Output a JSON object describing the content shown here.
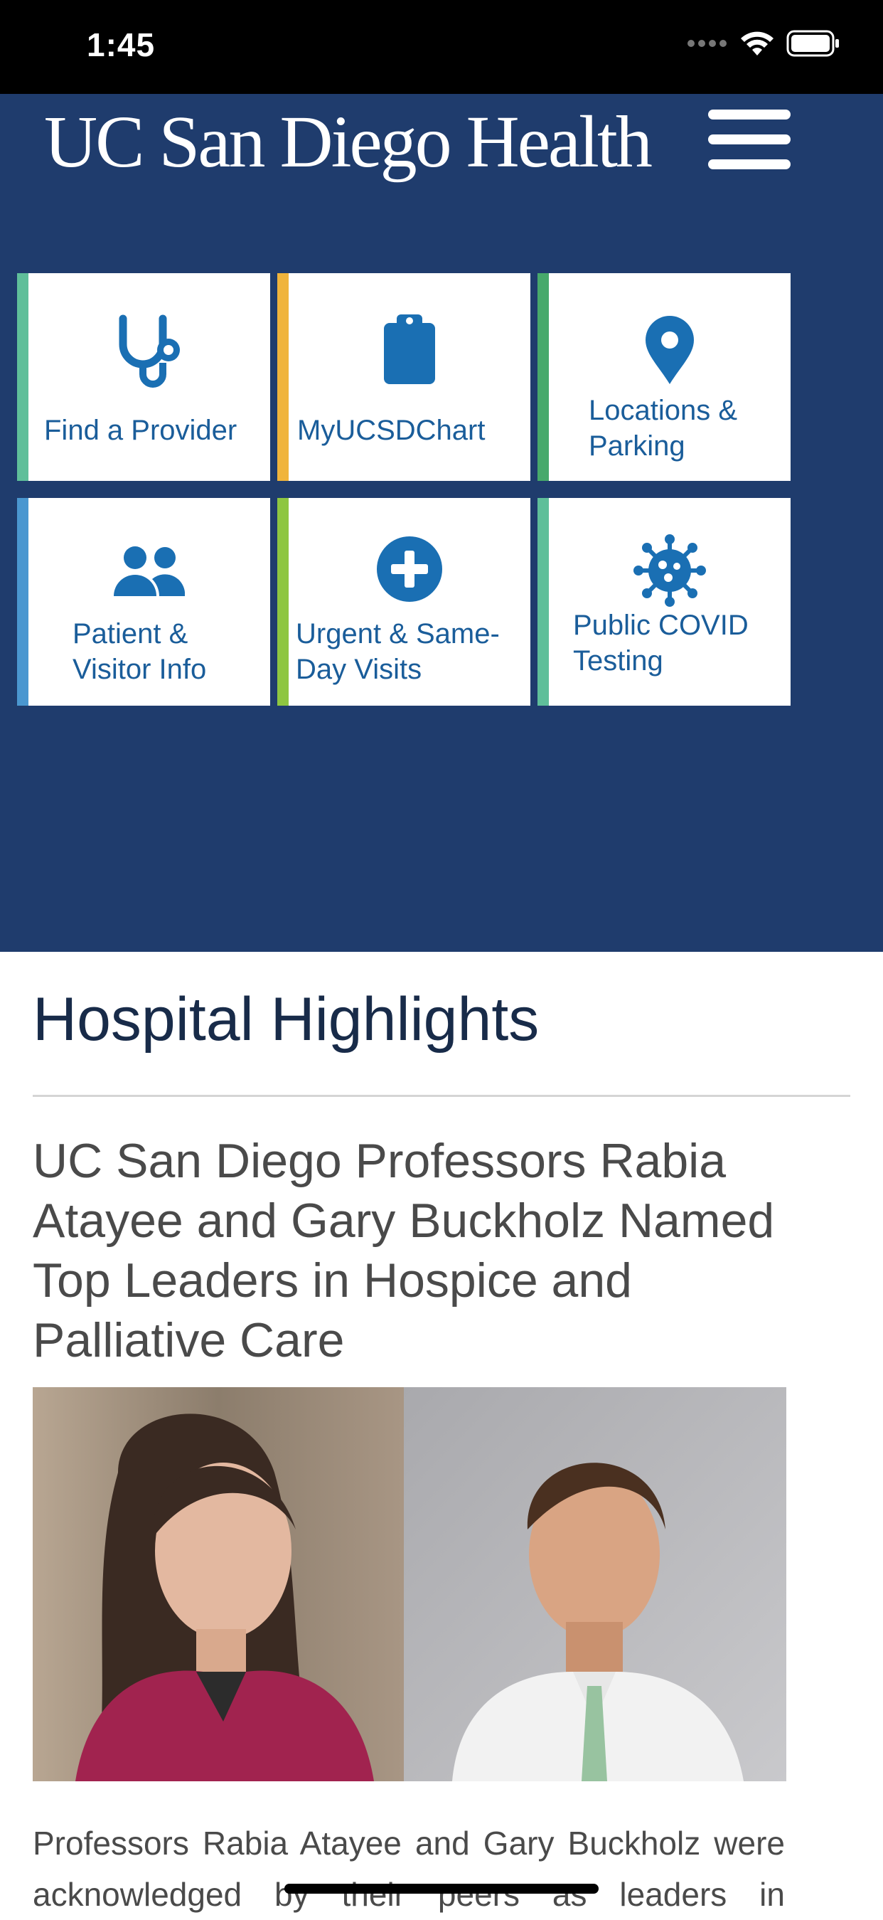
{
  "status": {
    "time": "1:45"
  },
  "header": {
    "logo_text": "UC San Diego Health",
    "menu_label": "Menu"
  },
  "tiles": [
    {
      "label": "Find a Provider",
      "icon": "stethoscope-icon",
      "accent": "#5fbf9a"
    },
    {
      "label": "MyUCSDChart",
      "icon": "clipboard-icon",
      "accent": "#f0b43c"
    },
    {
      "label": "Locations & Parking",
      "icon": "map-pin-icon",
      "accent": "#47a96b"
    },
    {
      "label": "Patient & Visitor Info",
      "icon": "people-icon",
      "accent": "#4a97d0"
    },
    {
      "label": "Urgent & Same-Day Visits",
      "icon": "plus-circle-icon",
      "accent": "#8ec641"
    },
    {
      "label": "Public COVID Testing",
      "icon": "virus-icon",
      "accent": "#5fbf9a"
    }
  ],
  "highlights": {
    "section_title": "Hospital Highlights",
    "article_title": "UC San Diego Professors Rabia Atayee and Gary Buckholz Named Top Leaders in Hospice and Palliative Care",
    "article_text": "Professors Rabia Atayee and Gary Buckholz were acknowledged by their peers as leaders in"
  },
  "colors": {
    "header_bg": "#1f3c6d",
    "icon_blue": "#1a6fb3",
    "title_navy": "#182b49"
  }
}
